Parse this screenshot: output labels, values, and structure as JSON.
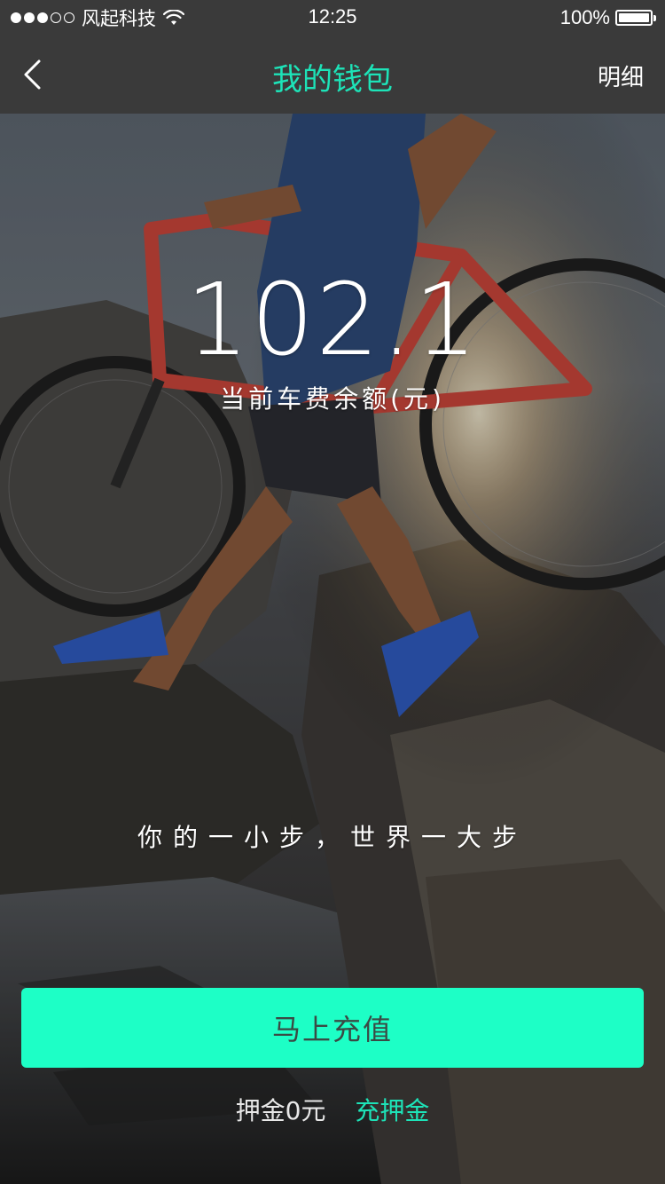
{
  "status_bar": {
    "carrier": "风起科技",
    "time": "12:25",
    "battery": "100%",
    "signal_full": 3,
    "signal_empty": 2
  },
  "nav": {
    "back_icon": "chevron-left-icon",
    "title": "我的钱包",
    "detail_label": "明细"
  },
  "wallet": {
    "balance": "102.1",
    "balance_label": "当前车费余额(元)"
  },
  "slogan": "你的一小步，世界一大步",
  "actions": {
    "recharge_label": "马上充值",
    "deposit_text": "押金0元",
    "deposit_link": "充押金"
  },
  "colors": {
    "accent": "#1de3b8",
    "button_bg": "#1dffc6",
    "bar_bg": "#3a3a3a"
  }
}
